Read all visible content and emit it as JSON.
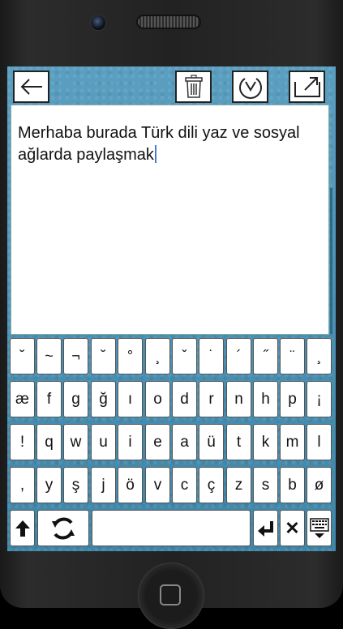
{
  "toolbar": {
    "back_icon": "back-arrow-icon",
    "delete_icon": "trash-icon",
    "download_icon": "download-circle-icon",
    "share_icon": "share-export-icon"
  },
  "editor": {
    "text_line1": "Merhaba burada Türk dili yaz ve sosyal",
    "text_line2": "ağlarda paylaşmak"
  },
  "keyboard": {
    "row1": [
      "˘",
      "~",
      "¬",
      "˘",
      "°",
      "¸",
      "ˇ",
      "˙",
      "´",
      "˝",
      "¨",
      "¸"
    ],
    "row2": [
      "æ",
      "f",
      "g",
      "ğ",
      "ı",
      "o",
      "d",
      "r",
      "n",
      "h",
      "p",
      "¡"
    ],
    "row3": [
      "!",
      "q",
      "w",
      "u",
      "i",
      "e",
      "a",
      "ü",
      "t",
      "k",
      "m",
      "l"
    ],
    "row4": [
      ",",
      "y",
      "ş",
      "j",
      "ö",
      "v",
      "c",
      "ç",
      "z",
      "s",
      "b",
      "ø"
    ],
    "bottom": {
      "shift_icon": "shift-up-arrow-icon",
      "cycle_icon": "refresh-cycle-icon",
      "return_icon": "return-enter-icon",
      "delete_label": "✕",
      "hide_icon": "keyboard-hide-icon"
    }
  }
}
